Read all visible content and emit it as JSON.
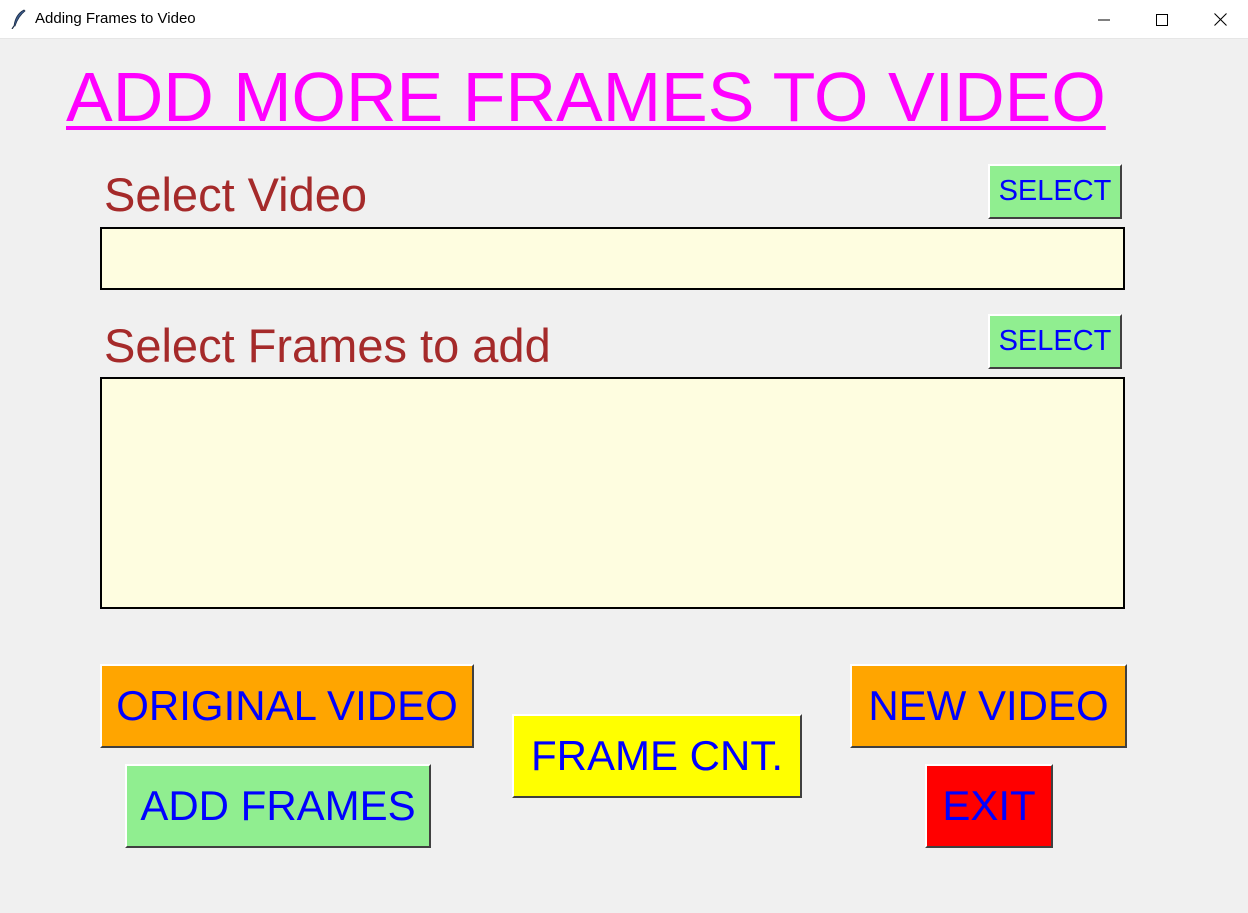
{
  "window": {
    "title": "Adding Frames to Video",
    "icon": "feather-icon"
  },
  "heading": "ADD MORE FRAMES TO VIDEO",
  "video_section": {
    "label": "Select Video",
    "select_label": "SELECT",
    "value": ""
  },
  "frames_section": {
    "label": "Select Frames to add",
    "select_label": "SELECT",
    "value": ""
  },
  "buttons": {
    "original_video": "ORIGINAL VIDEO",
    "add_frames": "ADD FRAMES",
    "frame_count": "FRAME CNT.",
    "new_video": "NEW VIDEO",
    "exit": "EXIT"
  },
  "colors": {
    "heading": "#ff00ff",
    "label": "#a52a2a",
    "button_text": "#0000ff",
    "select_button_bg": "#90ee90",
    "orange_button_bg": "#ffa500",
    "yellow_button_bg": "#ffff00",
    "exit_button_bg": "#ff0000",
    "text_box_bg": "#fefde0"
  }
}
